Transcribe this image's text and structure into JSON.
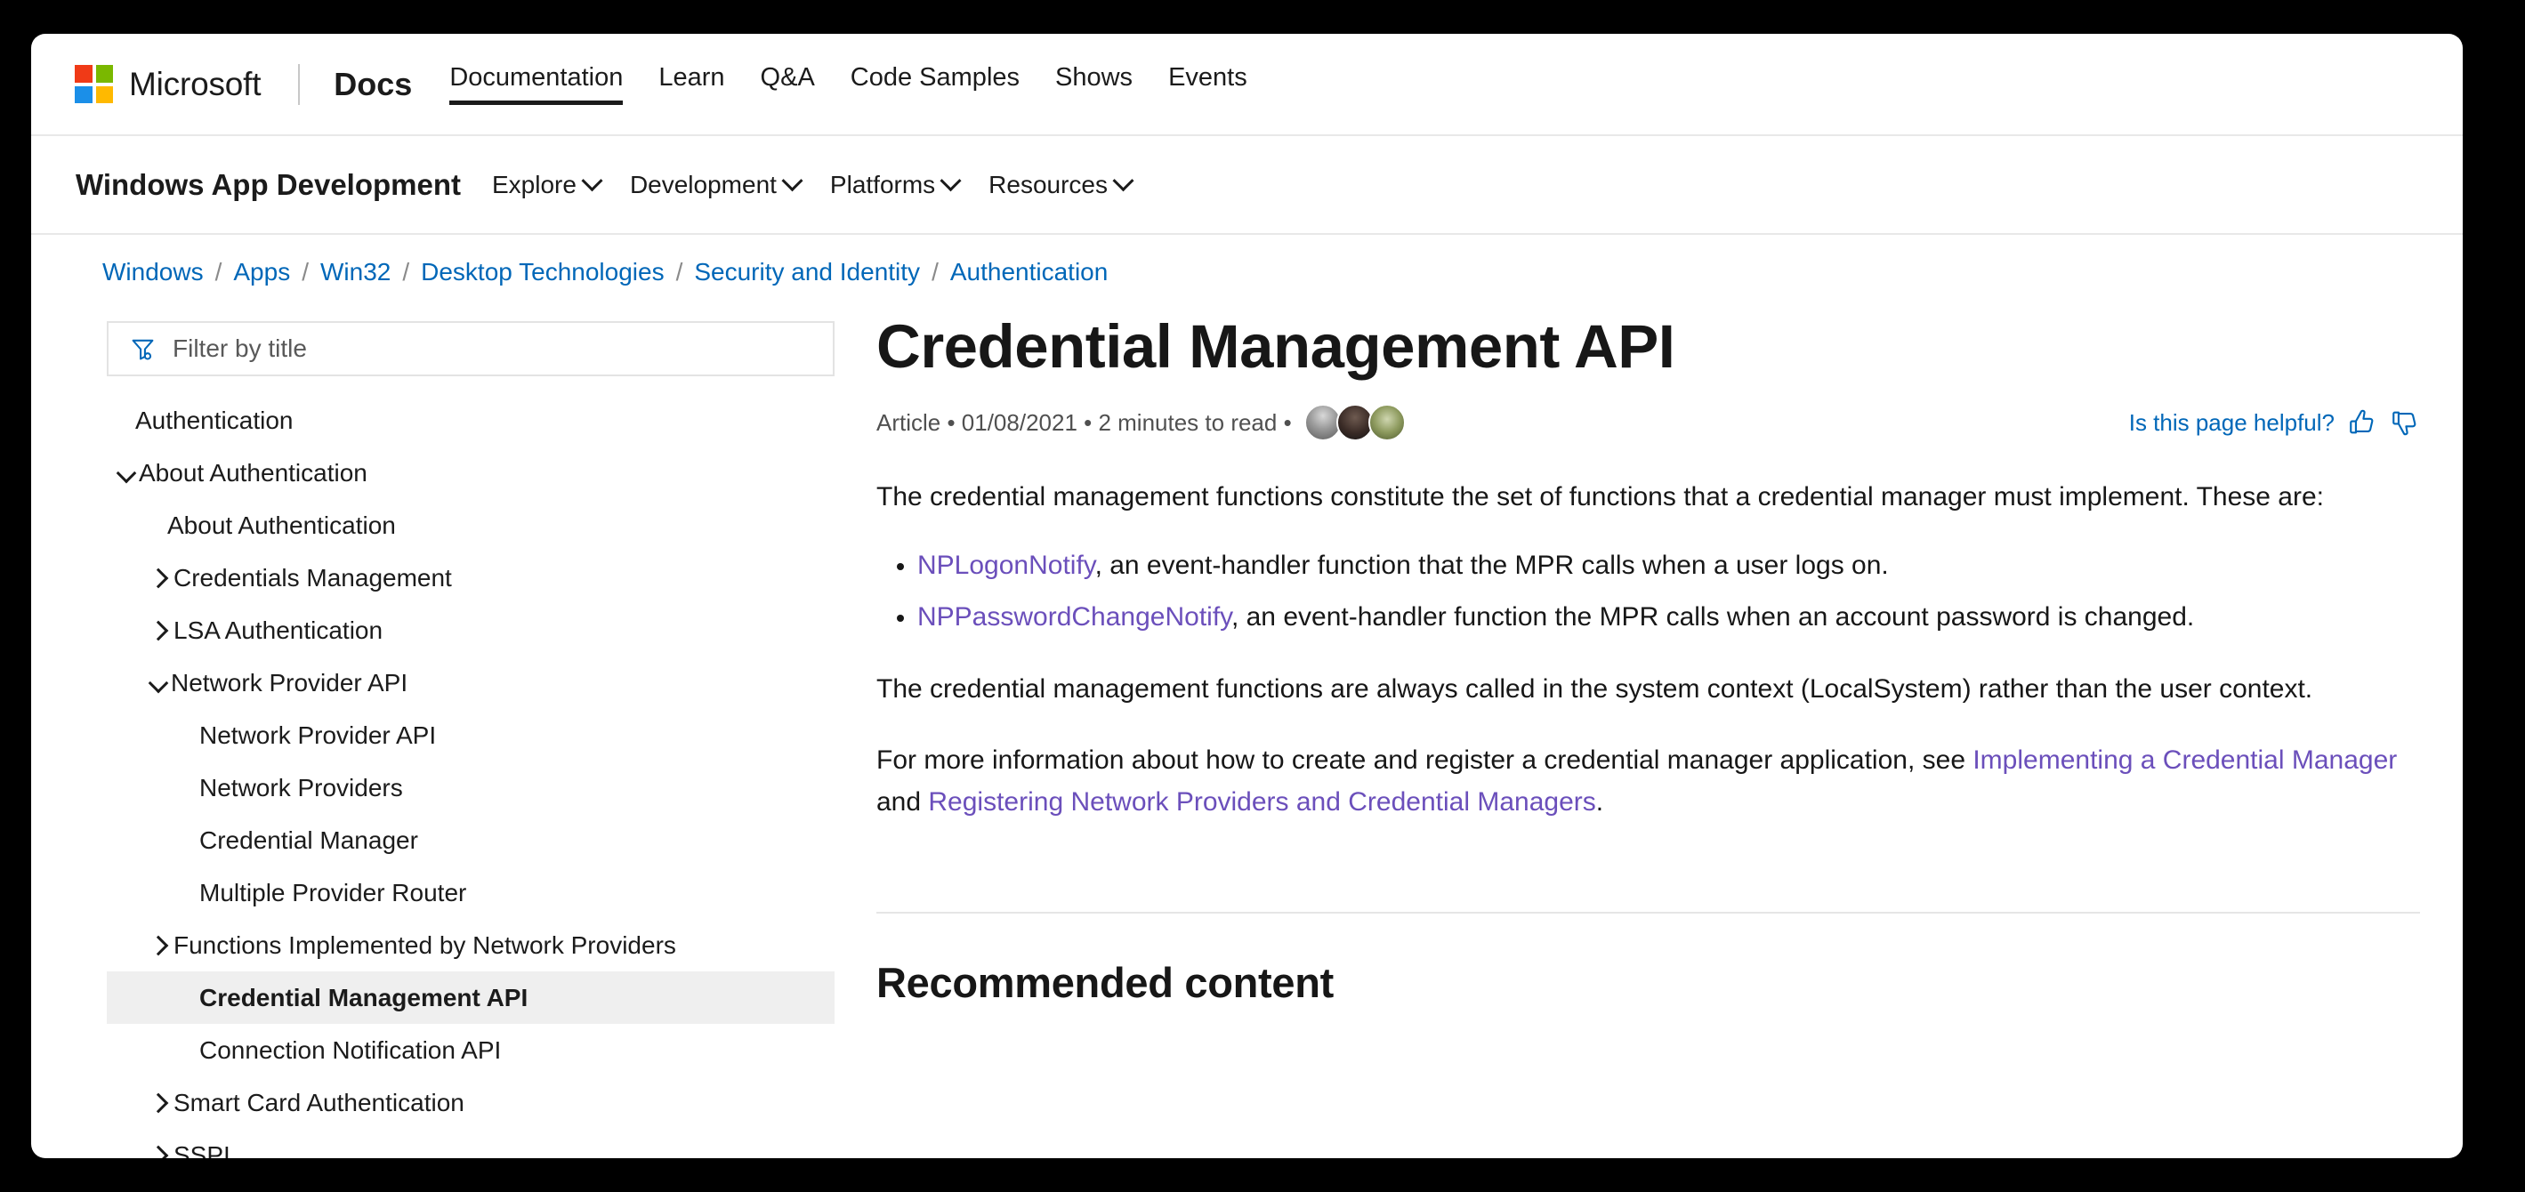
{
  "global_bar": {
    "brand_name": "Microsoft",
    "docs_label": "Docs",
    "nav_items": [
      {
        "label": "Documentation",
        "active": true
      },
      {
        "label": "Learn",
        "active": false
      },
      {
        "label": "Q&A",
        "active": false
      },
      {
        "label": "Code Samples",
        "active": false
      },
      {
        "label": "Shows",
        "active": false
      },
      {
        "label": "Events",
        "active": false
      }
    ]
  },
  "product_bar": {
    "title": "Windows App Development",
    "nav_items": [
      {
        "label": "Explore"
      },
      {
        "label": "Development"
      },
      {
        "label": "Platforms"
      },
      {
        "label": "Resources"
      }
    ]
  },
  "breadcrumb": {
    "separator": "/",
    "items": [
      "Windows",
      "Apps",
      "Win32",
      "Desktop Technologies",
      "Security and Identity",
      "Authentication"
    ]
  },
  "sidebar": {
    "filter": {
      "placeholder": "Filter by title",
      "value": "",
      "icon": "filter-funnel-icon"
    },
    "toc": [
      {
        "label": "Authentication",
        "level": 0,
        "chevron": "none",
        "selected": false
      },
      {
        "label": "About Authentication",
        "level": 0,
        "chevron": "expanded",
        "selected": false
      },
      {
        "label": "About Authentication",
        "level": 1,
        "chevron": "none",
        "selected": false
      },
      {
        "label": "Credentials Management",
        "level": 1,
        "chevron": "collapsed",
        "selected": false
      },
      {
        "label": "LSA Authentication",
        "level": 1,
        "chevron": "collapsed",
        "selected": false
      },
      {
        "label": "Network Provider API",
        "level": 1,
        "chevron": "expanded",
        "selected": false
      },
      {
        "label": "Network Provider API",
        "level": 2,
        "chevron": "none",
        "selected": false
      },
      {
        "label": "Network Providers",
        "level": 2,
        "chevron": "none",
        "selected": false
      },
      {
        "label": "Credential Manager",
        "level": 2,
        "chevron": "none",
        "selected": false
      },
      {
        "label": "Multiple Provider Router",
        "level": 2,
        "chevron": "none",
        "selected": false
      },
      {
        "label": "Functions Implemented by Network Providers",
        "level": 2,
        "chevron": "collapsed",
        "selected": false
      },
      {
        "label": "Credential Management API",
        "level": 2,
        "chevron": "none",
        "selected": true
      },
      {
        "label": "Connection Notification API",
        "level": 2,
        "chevron": "none",
        "selected": false
      },
      {
        "label": "Smart Card Authentication",
        "level": 1,
        "chevron": "collapsed",
        "selected": false
      },
      {
        "label": "SSPI",
        "level": 1,
        "chevron": "collapsed",
        "selected": false
      }
    ]
  },
  "article": {
    "title": "Credential Management API",
    "meta": "Article • 01/08/2021 • 2 minutes to read •",
    "contributor_count": 3,
    "helpful": {
      "label": "Is this page helpful?",
      "thumbs_up_icon": "thumbs-up-icon",
      "thumbs_down_icon": "thumbs-down-icon"
    },
    "paragraph_1": "The credential management functions constitute the set of functions that a credential manager must implement. These are:",
    "bullets": [
      {
        "link": "NPLogonNotify",
        "rest": ", an event-handler function that the MPR calls when a user logs on."
      },
      {
        "link": "NPPasswordChangeNotify",
        "rest": ", an event-handler function the MPR calls when an account password is changed."
      }
    ],
    "paragraph_2": "The credential management functions are always called in the system context (LocalSystem) rather than the user context.",
    "paragraph_3": {
      "lead": "For more information about how to create and register a credential manager application, see ",
      "link_1": "Implementing a Credential Manager",
      "joiner": " and ",
      "link_2": "Registering Network Providers and Credential Managers",
      "tail": "."
    },
    "recommended_heading": "Recommended content"
  },
  "colors": {
    "link_blue": "#0067b8",
    "visited_purple": "#6b4fbb",
    "text": "#171717",
    "selected_bg": "#efefef",
    "ms_red": "#f03a17",
    "ms_green": "#7ab800",
    "ms_blue": "#1b8fe8",
    "ms_orange": "#ffb900"
  }
}
